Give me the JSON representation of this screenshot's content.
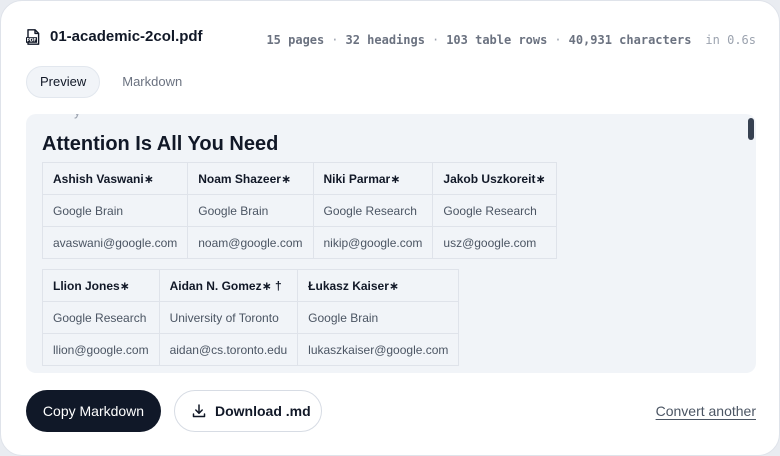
{
  "file": {
    "icon": "pdf-file-icon",
    "name": "01-academic-2col.pdf",
    "stats": {
      "pages": "15 pages",
      "headings": "32 headings",
      "table_rows": "103 table rows",
      "characters": "40,931 characters",
      "time": "in 0.6s"
    }
  },
  "tabs": [
    {
      "label": "Preview",
      "active": true
    },
    {
      "label": "Markdown",
      "active": false
    }
  ],
  "preview": {
    "title": "Attention Is All You Need",
    "table1": [
      [
        "Ashish Vaswani∗",
        "Noam Shazeer∗",
        "Niki Parmar∗",
        "Jakob Uszkoreit∗"
      ],
      [
        "Google Brain",
        "Google Brain",
        "Google Research",
        "Google Research"
      ],
      [
        "avaswani@google.com",
        "noam@google.com",
        "nikip@google.com",
        "usz@google.com"
      ]
    ],
    "table2": [
      [
        "Llion Jones∗",
        "Aidan N. Gomez∗ †",
        "Łukasz Kaiser∗"
      ],
      [
        "Google Research",
        "University of Toronto",
        "Google Brain"
      ],
      [
        "llion@google.com",
        "aidan@cs.toronto.edu",
        "lukaszkaiser@google.com"
      ]
    ]
  },
  "actions": {
    "copy_label": "Copy Markdown",
    "download_label": "Download .md",
    "download_icon": "download-icon",
    "convert_label": "Convert another"
  }
}
